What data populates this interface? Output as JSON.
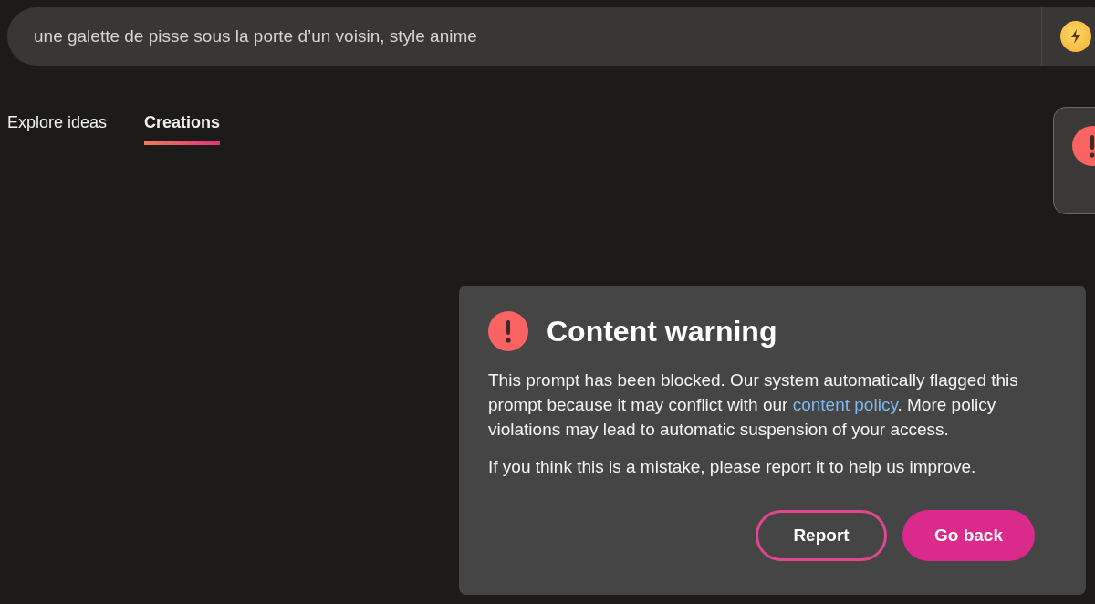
{
  "search": {
    "value": "une galette de pisse sous la porte d’un voisin, style anime"
  },
  "tabs": [
    {
      "label": "Explore ideas",
      "selected": false
    },
    {
      "label": "Creations",
      "selected": true
    }
  ],
  "dialog": {
    "title": "Content warning",
    "message": {
      "before": "This prompt has been blocked. Our system automatically flagged this prompt because it may conflict with our ",
      "link": "content policy",
      "after": ". More policy violations may lead to automatic suspension of your access."
    },
    "note": "If you think this is a mistake, please report it to help us improve.",
    "buttons": [
      {
        "label": "Report",
        "kind": "outline"
      },
      {
        "label": "Go back",
        "kind": "primary"
      }
    ]
  }
}
